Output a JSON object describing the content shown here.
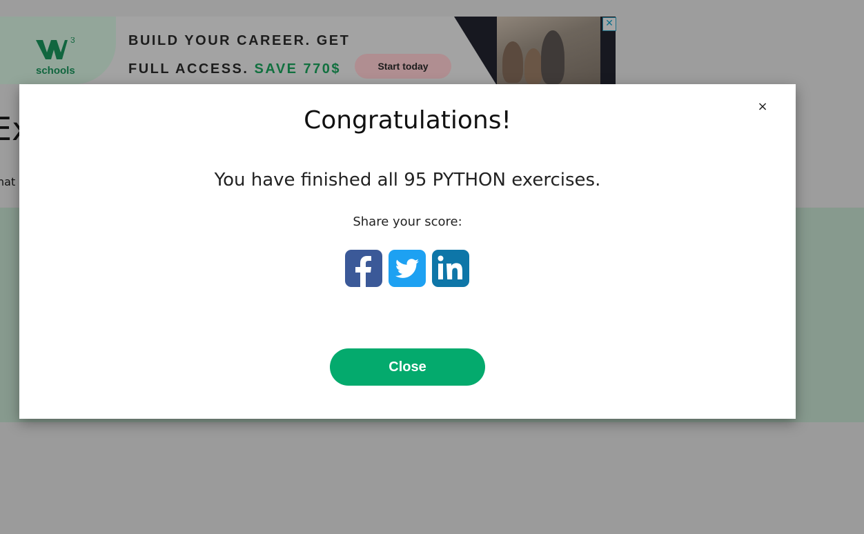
{
  "background": {
    "heading_fragment": "Ex",
    "subtext_fragment": "hat"
  },
  "ad": {
    "logo_text": "schools",
    "logo_superscript": "3",
    "headline_line1": "BUILD YOUR CAREER. GET",
    "headline_line2_prefix": "FULL ACCESS.",
    "headline_line2_highlight": "SAVE 770$",
    "cta_label": "Start today",
    "close_glyph": "✕",
    "colors": {
      "brand_green": "#04aa6d",
      "cta_pink": "#ffc0c7"
    }
  },
  "modal": {
    "title": "Congratulations!",
    "message": "You have finished all 95 PYTHON exercises.",
    "share_label": "Share your score:",
    "close_x": "×",
    "close_button_label": "Close",
    "share_buttons": [
      {
        "network": "facebook",
        "icon": "facebook-icon",
        "color": "#3b5998"
      },
      {
        "network": "twitter",
        "icon": "twitter-icon",
        "color": "#1da1f2"
      },
      {
        "network": "linkedin",
        "icon": "linkedin-icon",
        "color": "#0e76a8"
      }
    ],
    "colors": {
      "close_button": "#04aa6d",
      "overlay": "rgba(0,0,0,0.4)"
    }
  }
}
